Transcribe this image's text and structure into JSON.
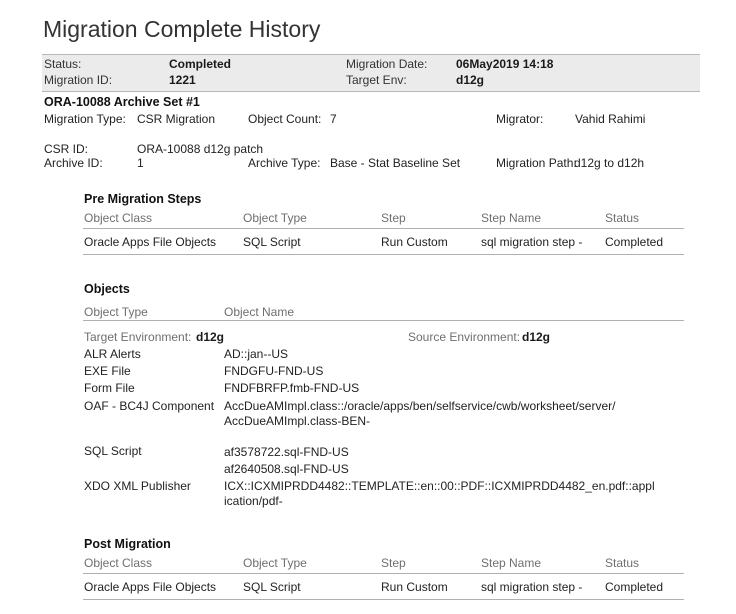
{
  "page": {
    "title": "Migration Complete History"
  },
  "summary": {
    "status_label": "Status:",
    "status_value": "Completed",
    "migration_id_label": "Migration ID:",
    "migration_id_value": "1221",
    "migration_date_label": "Migration Date:",
    "migration_date_value": "06May2019 14:18",
    "target_env_label": "Target Env:",
    "target_env_value": "d12g"
  },
  "archive": {
    "heading": "ORA-10088 Archive Set #1",
    "migration_type_label": "Migration Type:",
    "migration_type_value": "CSR Migration",
    "object_count_label": "Object Count:",
    "object_count_value": "7",
    "migrator_label": "Migrator:",
    "migrator_value": "Vahid Rahimi",
    "csr_id_label": "CSR ID:",
    "csr_id_value": "ORA-10088  d12g patch",
    "archive_id_label": "Archive ID:",
    "archive_id_value": "1",
    "archive_type_label": "Archive Type:",
    "archive_type_value": "Base - Stat Baseline Set",
    "migration_path_label": "Migration Path:",
    "migration_path_value": "d12g to d12h"
  },
  "pre_steps": {
    "heading": "Pre Migration Steps",
    "columns": [
      "Object Class",
      "Object Type",
      "Step",
      "Step Name",
      "Status"
    ],
    "rows": [
      [
        "Oracle Apps File Objects",
        "SQL Script",
        "Run Custom",
        "sql migration step -",
        "Completed"
      ]
    ]
  },
  "objects": {
    "heading": "Objects",
    "columns": [
      "Object Type",
      "Object Name"
    ],
    "target_env_label": "Target Environment:",
    "target_env_value": "d12g",
    "source_env_label": "Source Environment:",
    "source_env_value": "d12g",
    "rows": [
      {
        "type": "ALR Alerts",
        "name": "AD::jan--US"
      },
      {
        "type": "EXE File",
        "name": "FNDGFU-FND-US"
      },
      {
        "type": "Form File",
        "name": "FNDFBRFP.fmb-FND-US"
      },
      {
        "type": "OAF - BC4J Component",
        "name": "AccDueAMImpl.class::/oracle/apps/ben/selfservice/cwb/worksheet/server/\nAccDueAMImpl.class-BEN-"
      },
      {
        "type": "SQL Script",
        "name": "af3578722.sql-FND-US\naf2640508.sql-FND-US"
      },
      {
        "type": "XDO XML Publisher",
        "name": "ICX::ICXMIPRDD4482::TEMPLATE::en::00::PDF::ICXMIPRDD4482_en.pdf::appl\nication/pdf-"
      }
    ]
  },
  "post": {
    "heading": "Post Migration",
    "columns": [
      "Object Class",
      "Object Type",
      "Step",
      "Step Name",
      "Status"
    ],
    "rows": [
      [
        "Oracle Apps File Objects",
        "SQL Script",
        "Run Custom",
        "sql migration step -",
        "Completed"
      ]
    ]
  }
}
